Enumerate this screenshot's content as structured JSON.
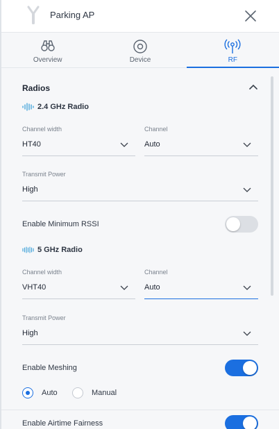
{
  "header": {
    "title": "Parking AP",
    "device_icon": "access-point-icon",
    "close_icon": "close-icon"
  },
  "tabs": [
    {
      "label": "Overview",
      "icon": "binoculars-icon",
      "active": false
    },
    {
      "label": "Device",
      "icon": "disc-icon",
      "active": false
    },
    {
      "label": "RF",
      "icon": "antenna-icon",
      "active": true
    }
  ],
  "radios": {
    "section_title": "Radios",
    "radio24": {
      "title": "2.4 GHz Radio",
      "channel_width": {
        "label": "Channel width",
        "value": "HT40"
      },
      "channel": {
        "label": "Channel",
        "value": "Auto"
      },
      "transmit_power": {
        "label": "Transmit Power",
        "value": "High"
      }
    },
    "min_rssi": {
      "label": "Enable Minimum RSSI",
      "enabled": false
    },
    "radio5": {
      "title": "5 GHz Radio",
      "channel_width": {
        "label": "Channel width",
        "value": "VHT40"
      },
      "channel": {
        "label": "Channel",
        "value": "Auto"
      },
      "transmit_power": {
        "label": "Transmit Power",
        "value": "High"
      }
    },
    "meshing": {
      "label": "Enable Meshing",
      "enabled": true,
      "options": [
        "Auto",
        "Manual"
      ],
      "selected": "Auto"
    },
    "airtime": {
      "label": "Enable Airtime Fairness",
      "enabled": true
    }
  },
  "colors": {
    "accent": "#1b6fe0",
    "background": "#f6f7f9",
    "text": "#1f2633"
  }
}
